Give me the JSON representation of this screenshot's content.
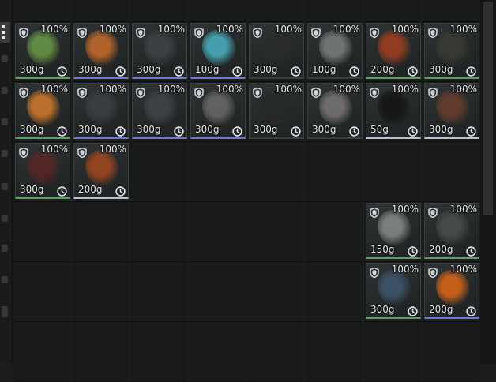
{
  "colors": {
    "background": "#1c1d1d",
    "slot": "#191a1a",
    "text": "#e8e8e8",
    "rarity_green": "#5aa35a",
    "rarity_blue": "#6e7ad0",
    "rarity_white": "#b9c2cf"
  },
  "icons": [
    "shield-icon",
    "clock-icon",
    "inventory-tab-icon"
  ],
  "inventory": {
    "columns": 8,
    "items": [
      {
        "name": "green-herb",
        "rarity": "g",
        "durability": "100%",
        "weight": "300g",
        "col": 0,
        "row": 0,
        "color": "#6b9a48"
      },
      {
        "name": "swirl-orange",
        "rarity": "b",
        "durability": "100%",
        "weight": "300g",
        "col": 1,
        "row": 0,
        "color": "#c86d2a"
      },
      {
        "name": "dark-flower",
        "rarity": "b",
        "durability": "100%",
        "weight": "300g",
        "col": 2,
        "row": 0,
        "color": "#3f4446"
      },
      {
        "name": "cyan-ring",
        "rarity": "b",
        "durability": "100%",
        "weight": "100g",
        "col": 3,
        "row": 0,
        "color": "#4ab2c2"
      },
      {
        "name": "dark-leaf",
        "rarity": "n",
        "durability": "100%",
        "weight": "300g",
        "col": 4,
        "row": 0,
        "color": "#2b2d2d"
      },
      {
        "name": "grey-rose",
        "rarity": "n",
        "durability": "100%",
        "weight": "100g",
        "col": 5,
        "row": 0,
        "color": "#7d7f80"
      },
      {
        "name": "red-fruit",
        "rarity": "g",
        "durability": "100%",
        "weight": "200g",
        "col": 6,
        "row": 0,
        "color": "#a2401f"
      },
      {
        "name": "dark-thorn",
        "rarity": "g",
        "durability": "100%",
        "weight": "300g",
        "col": 7,
        "row": 0,
        "color": "#3a3d33"
      },
      {
        "name": "swirl-orange-2",
        "rarity": "g",
        "durability": "100%",
        "weight": "300g",
        "col": 0,
        "row": 1,
        "color": "#d47c2c"
      },
      {
        "name": "dark-flower-2",
        "rarity": "b",
        "durability": "100%",
        "weight": "300g",
        "col": 1,
        "row": 1,
        "color": "#3b4144"
      },
      {
        "name": "dark-flower-3",
        "rarity": "b",
        "durability": "100%",
        "weight": "300g",
        "col": 2,
        "row": 1,
        "color": "#404648"
      },
      {
        "name": "grey-rose-2",
        "rarity": "b",
        "durability": "100%",
        "weight": "300g",
        "col": 3,
        "row": 1,
        "color": "#6e6a6a"
      },
      {
        "name": "dark-leaf-2",
        "rarity": "n",
        "durability": "100%",
        "weight": "300g",
        "col": 4,
        "row": 1,
        "color": "#272929"
      },
      {
        "name": "grey-rose-3",
        "rarity": "n",
        "durability": "100%",
        "weight": "300g",
        "col": 5,
        "row": 1,
        "color": "#7a7676"
      },
      {
        "name": "black-feather",
        "rarity": "w",
        "durability": "100%",
        "weight": "50g",
        "col": 6,
        "row": 1,
        "color": "#121313"
      },
      {
        "name": "brown-pod",
        "rarity": "w",
        "durability": "100%",
        "weight": "300g",
        "col": 7,
        "row": 1,
        "color": "#6a3e2c"
      },
      {
        "name": "dark-berry",
        "rarity": "g",
        "durability": "100%",
        "weight": "300g",
        "col": 0,
        "row": 2,
        "color": "#5a2626"
      },
      {
        "name": "orange-bulb",
        "rarity": "w",
        "durability": "100%",
        "weight": "200g",
        "col": 1,
        "row": 2,
        "color": "#a4481e"
      },
      {
        "name": "grey-claw",
        "rarity": "g",
        "durability": "100%",
        "weight": "150g",
        "col": 6,
        "row": 3,
        "color": "#8a8c8c"
      },
      {
        "name": "dark-spike",
        "rarity": "g",
        "durability": "100%",
        "weight": "200g",
        "col": 7,
        "row": 3,
        "color": "#4b4f4f"
      },
      {
        "name": "blue-shell",
        "rarity": "g",
        "durability": "100%",
        "weight": "300g",
        "col": 6,
        "row": 4,
        "color": "#3f566e"
      },
      {
        "name": "fire-orb",
        "rarity": "b",
        "durability": "100%",
        "weight": "200g",
        "col": 7,
        "row": 4,
        "color": "#e06818"
      }
    ]
  }
}
